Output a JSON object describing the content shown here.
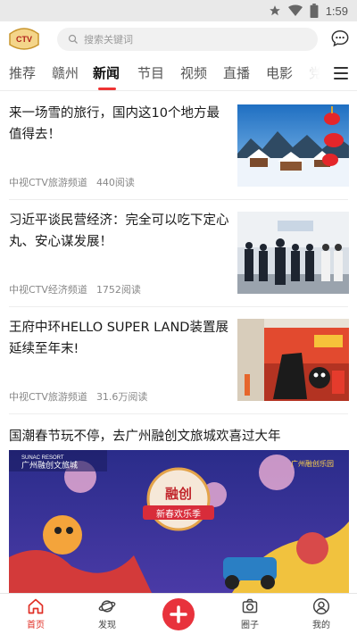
{
  "status_bar": {
    "time": "1:59"
  },
  "header": {
    "logo_text": "CTV",
    "search_placeholder": "搜索关键词"
  },
  "tabs": [
    "推荐",
    "赣州",
    "新闻",
    "节目",
    "视频",
    "直播",
    "电影",
    "党"
  ],
  "active_tab": "新闻",
  "news": [
    {
      "title": "来一场雪的旅行，国内这10个地方最值得去！",
      "source": "中视CTV旅游频道",
      "reads": "440阅读"
    },
    {
      "title": "习近平谈民营经济：完全可以吃下定心丸、安心谋发展！",
      "source": "中视CTV经济频道",
      "reads": "1752阅读"
    },
    {
      "title": "王府中环HELLO SUPER LAND装置展延续至年末!",
      "source": "中视CTV旅游频道",
      "reads": "31.6万阅读"
    }
  ],
  "featured": {
    "title": "国潮春节玩不停，去广州融创文旅城欢喜过大年",
    "banner_brand": "广州融创文旅城",
    "banner_brand_small": "SUNAC RESORT",
    "banner_main": "融创",
    "banner_sub": "新春欢乐季",
    "banner_corner": "广州融创乐园"
  },
  "bottom_nav": [
    {
      "label": "首页",
      "icon": "home-icon"
    },
    {
      "label": "发现",
      "icon": "planet-icon"
    },
    {
      "label": "",
      "icon": "plus-icon"
    },
    {
      "label": "圈子",
      "icon": "camera-icon"
    },
    {
      "label": "我的",
      "icon": "user-icon"
    }
  ],
  "colors": {
    "accent": "#e8323c",
    "active_text": "#e02e24"
  }
}
